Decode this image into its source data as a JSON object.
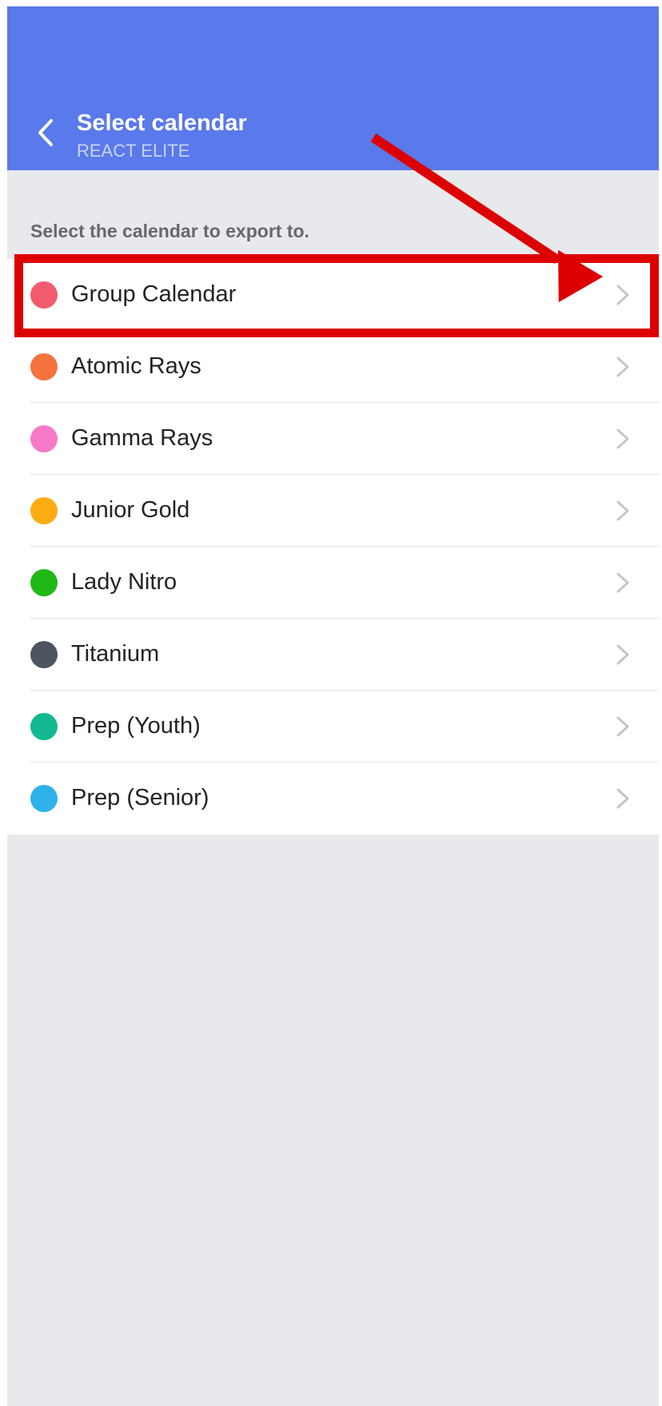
{
  "header": {
    "title": "Select calendar",
    "subtitle": "REACT ELITE",
    "color": "#5a79ea"
  },
  "section_label": "Select the calendar to export to.",
  "calendars": [
    {
      "label": "Group Calendar",
      "color": "#f25b6e"
    },
    {
      "label": "Atomic Rays",
      "color": "#f4733e"
    },
    {
      "label": "Gamma Rays",
      "color": "#f77ac8"
    },
    {
      "label": "Junior Gold",
      "color": "#fbac13"
    },
    {
      "label": "Lady Nitro",
      "color": "#1fb816"
    },
    {
      "label": "Titanium",
      "color": "#4d5561"
    },
    {
      "label": "Prep (Youth)",
      "color": "#11b890"
    },
    {
      "label": "Prep (Senior)",
      "color": "#2fb1e9"
    }
  ],
  "annotation": {
    "color": "#dd0000"
  }
}
